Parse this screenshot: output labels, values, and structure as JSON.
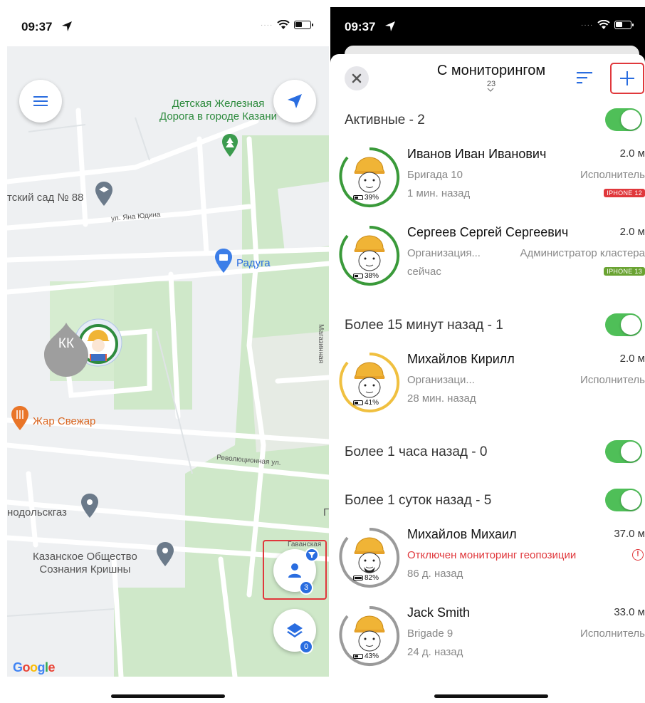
{
  "left": {
    "status_time": "09:37",
    "map_labels": {
      "railway": "Детская Железная\nДорога в городе Казани",
      "kindergarten": "тский сад № 88",
      "street_yana": "ул. Яна Юдина",
      "raduga": "Радуга",
      "zhar": "Жар Свежар",
      "revolution": "Революционная ул.",
      "gavanskaya": "Гаванская",
      "magazin": "Магазинная",
      "gas": "нодольскгаз",
      "krishna": "Казанское Общество\nСознания Кришны",
      "ga": "Га"
    },
    "marker_initials": "КК",
    "people_badge": "3",
    "layers_badge": "0",
    "google": [
      "G",
      "o",
      "o",
      "g",
      "l",
      "e"
    ],
    "google_colors": [
      "#4285F4",
      "#EA4335",
      "#FBBC05",
      "#4285F4",
      "#34A853",
      "#EA4335"
    ]
  },
  "right": {
    "status_time": "09:37",
    "title": "С мониторингом",
    "subtitle": "23",
    "groups": [
      {
        "label": "Активные - 2"
      },
      {
        "label": "Более 15 минут назад - 1"
      },
      {
        "label": "Более 1 часа назад - 0"
      },
      {
        "label": "Более 1 суток назад - 5"
      }
    ],
    "people": [
      {
        "name": "Иванов Иван Иванович",
        "distance": "2.0 м",
        "org": "Бригада 10",
        "role": "Исполнитель",
        "time": "1 мин. назад",
        "battery": "39%",
        "tag": "IPHONE 12",
        "tag_color": "#e0383c",
        "ring": "#3a9a3a"
      },
      {
        "name": "Сергеев Сергей Сергеевич",
        "distance": "2.0 м",
        "org": "Организация...",
        "role": "Администратор кластера",
        "time": "сейчас",
        "battery": "38%",
        "tag": "IPHONE 13",
        "tag_color": "#6aa332",
        "ring": "#3a9a3a"
      },
      {
        "name": "Михайлов Кирилл",
        "distance": "2.0 м",
        "org": "Организаци...",
        "role": "Исполнитель",
        "time": "28 мин. назад",
        "battery": "41%",
        "ring": "#f0c040"
      },
      {
        "name": "Михайлов Михаил",
        "distance": "37.0 м",
        "warning": "Отключен мониторинг геопозиции",
        "time": "86 д. назад",
        "battery": "82%",
        "ring": "#9a9a9a"
      },
      {
        "name": "Jack Smith",
        "distance": "33.0 м",
        "org": "Brigade 9",
        "role": "Исполнитель",
        "time": "24 д. назад",
        "battery": "43%",
        "ring": "#9a9a9a"
      }
    ]
  },
  "icons": {
    "menu": "menu-icon",
    "locate": "navigation-arrow-icon",
    "people": "person-icon",
    "filter": "filter-icon",
    "layers": "layers-icon",
    "close": "close-icon",
    "sort": "sort-icon",
    "add": "plus-icon"
  }
}
